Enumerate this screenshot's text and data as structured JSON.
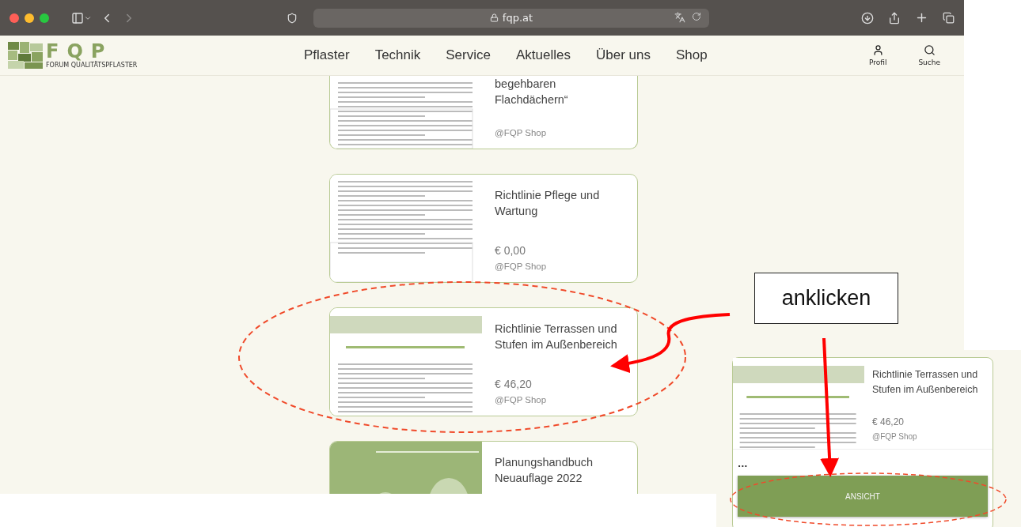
{
  "browser": {
    "url": "fqp.at"
  },
  "site": {
    "logo": {
      "mark": "FQP",
      "subtitle": "FORUM QUALITÄTSPFLASTER"
    },
    "nav": [
      "Pflaster",
      "Technik",
      "Service",
      "Aktuelles",
      "Über uns",
      "Shop"
    ],
    "actions": [
      {
        "kind": "profile",
        "label": "Profil"
      },
      {
        "kind": "search",
        "label": "Suche"
      }
    ]
  },
  "products": [
    {
      "title": "begehbaren Flachdächern“",
      "shop": "@FQP Shop",
      "kind": "document",
      "cut": true
    },
    {
      "title": "Richtlinie Pflege und Wartung",
      "price": "€ 0,00",
      "shop": "@FQP Shop",
      "kind": "document",
      "cut": false
    },
    {
      "title": "Richtlinie Terrassen und Stufen im Außenbereich",
      "price": "€ 46,20",
      "shop": "@FQP Shop",
      "kind": "banner",
      "cut": false
    },
    {
      "title": "Planungshandbuch Neuauflage 2022",
      "kind": "cover",
      "cut": false
    }
  ],
  "annotation": {
    "callout": "anklicken"
  },
  "inset": {
    "title": "Richtlinie Terrassen und Stufen im Außenbereich",
    "price": "€ 46,20",
    "shop": "@FQP Shop",
    "kind": "banner",
    "more": "...",
    "button": "ANSICHT"
  }
}
